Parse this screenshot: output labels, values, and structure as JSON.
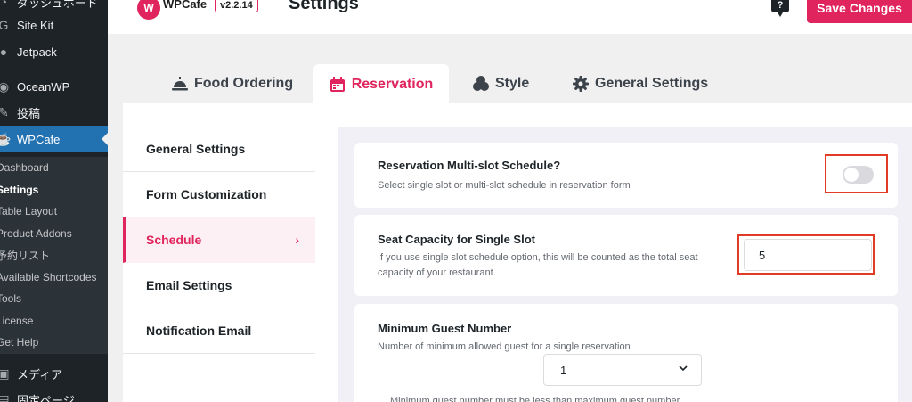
{
  "sidebar": {
    "items": [
      {
        "label": "ダッシュボード",
        "icon": "dashboard-icon"
      },
      {
        "label": "Site Kit",
        "icon": "sitekit-icon"
      },
      {
        "label": "Jetpack",
        "icon": "jetpack-icon"
      },
      {
        "label": "OceanWP",
        "icon": "oceanwp-icon"
      },
      {
        "label": "投稿",
        "icon": "pin-icon"
      },
      {
        "label": "WPCafe",
        "icon": "wpcafe-icon"
      },
      {
        "label": "メディア",
        "icon": "media-icon"
      },
      {
        "label": "固定ページ",
        "icon": "page-icon"
      }
    ],
    "submenu": [
      "Dashboard",
      "Settings",
      "Table Layout",
      "Product Addons",
      "予約リスト",
      "Available Shortcodes",
      "Tools",
      "License",
      "Get Help"
    ]
  },
  "header": {
    "logo_text": "WPCafe",
    "version": "v2.2.14",
    "title": "Settings",
    "help": "?",
    "save_label": "Save Changes"
  },
  "tabs": [
    {
      "label": "Food Ordering",
      "icon": "food-cloche-icon"
    },
    {
      "label": "Reservation",
      "icon": "calendar-icon"
    },
    {
      "label": "Style",
      "icon": "style-icon"
    },
    {
      "label": "General Settings",
      "icon": "gear-icon"
    }
  ],
  "subnav": [
    "General Settings",
    "Form Customization",
    "Schedule",
    "Email Settings",
    "Notification Email"
  ],
  "settings": {
    "multislot": {
      "title": "Reservation Multi-slot Schedule?",
      "desc": "Select single slot or multi-slot schedule in reservation form",
      "enabled": false
    },
    "seat_capacity": {
      "title": "Seat Capacity for Single Slot",
      "desc": "If you use single slot schedule option, this will be counted as the total seat capacity of your restaurant.",
      "value": "5"
    },
    "min_guest": {
      "title": "Minimum Guest Number",
      "desc": "Number of minimum allowed guest for a single reservation",
      "value": "1",
      "note": "Minimum guest number must be less than maximum guest number"
    }
  },
  "colors": {
    "accent": "#e0245e",
    "highlight": "#e03b24",
    "wp_sidebar": "#1d2327",
    "wp_active": "#2271b1"
  }
}
